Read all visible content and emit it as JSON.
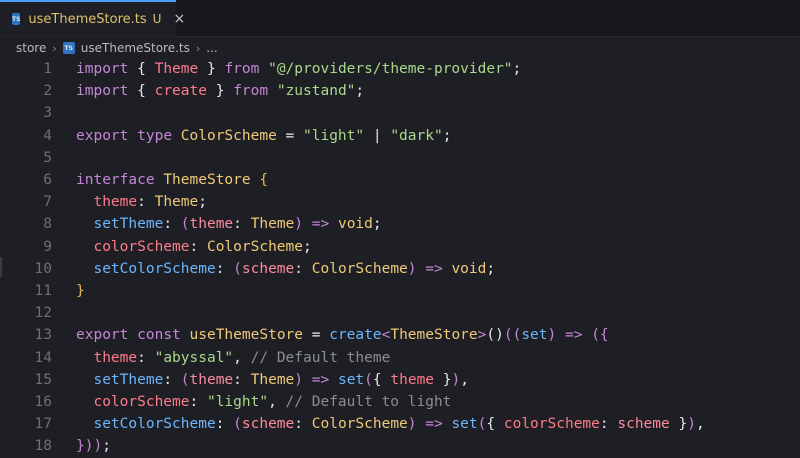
{
  "tab": {
    "badge": "TS",
    "name": "useThemeStore.ts",
    "status": "U",
    "close": "×"
  },
  "breadcrumb": {
    "folder": "store",
    "file": "useThemeStore.ts",
    "more": "..."
  },
  "lines": [
    {
      "n": "1",
      "tokens": [
        [
          "k",
          "import"
        ],
        [
          "o",
          " { "
        ],
        [
          "p",
          "Theme"
        ],
        [
          "o",
          " } "
        ],
        [
          "k",
          "from"
        ],
        [
          "o",
          " "
        ],
        [
          "s",
          "\"@/providers/theme-provider\""
        ],
        [
          "o",
          ";"
        ]
      ]
    },
    {
      "n": "2",
      "tokens": [
        [
          "k",
          "import"
        ],
        [
          "o",
          " { "
        ],
        [
          "p",
          "create"
        ],
        [
          "o",
          " } "
        ],
        [
          "k",
          "from"
        ],
        [
          "o",
          " "
        ],
        [
          "s",
          "\"zustand\""
        ],
        [
          "o",
          ";"
        ]
      ]
    },
    {
      "n": "3",
      "tokens": []
    },
    {
      "n": "4",
      "tokens": [
        [
          "k",
          "export"
        ],
        [
          "o",
          " "
        ],
        [
          "k",
          "type"
        ],
        [
          "o",
          " "
        ],
        [
          "t",
          "ColorScheme"
        ],
        [
          "o",
          " = "
        ],
        [
          "s",
          "\"light\""
        ],
        [
          "o",
          " | "
        ],
        [
          "s",
          "\"dark\""
        ],
        [
          "o",
          ";"
        ]
      ]
    },
    {
      "n": "5",
      "tokens": []
    },
    {
      "n": "6",
      "tokens": [
        [
          "k",
          "interface"
        ],
        [
          "o",
          " "
        ],
        [
          "t",
          "ThemeStore"
        ],
        [
          "o",
          " "
        ],
        [
          "br",
          "{"
        ]
      ]
    },
    {
      "n": "7",
      "tokens": [
        [
          "o",
          "  "
        ],
        [
          "p",
          "theme"
        ],
        [
          "o",
          ": "
        ],
        [
          "t",
          "Theme"
        ],
        [
          "o",
          ";"
        ]
      ]
    },
    {
      "n": "8",
      "tokens": [
        [
          "o",
          "  "
        ],
        [
          "f",
          "setTheme"
        ],
        [
          "o",
          ": "
        ],
        [
          "k",
          "("
        ],
        [
          "pm",
          "theme"
        ],
        [
          "o",
          ": "
        ],
        [
          "t",
          "Theme"
        ],
        [
          "k",
          ")"
        ],
        [
          "o",
          " "
        ],
        [
          "k",
          "=>"
        ],
        [
          "o",
          " "
        ],
        [
          "t",
          "void"
        ],
        [
          "o",
          ";"
        ]
      ]
    },
    {
      "n": "9",
      "tokens": [
        [
          "o",
          "  "
        ],
        [
          "p",
          "colorScheme"
        ],
        [
          "o",
          ": "
        ],
        [
          "t",
          "ColorScheme"
        ],
        [
          "o",
          ";"
        ]
      ]
    },
    {
      "n": "10",
      "tokens": [
        [
          "o",
          "  "
        ],
        [
          "f",
          "setColorScheme"
        ],
        [
          "o",
          ": "
        ],
        [
          "k",
          "("
        ],
        [
          "pm",
          "scheme"
        ],
        [
          "o",
          ": "
        ],
        [
          "t",
          "ColorScheme"
        ],
        [
          "k",
          ")"
        ],
        [
          "o",
          " "
        ],
        [
          "k",
          "=>"
        ],
        [
          "o",
          " "
        ],
        [
          "t",
          "void"
        ],
        [
          "o",
          ";"
        ]
      ]
    },
    {
      "n": "11",
      "tokens": [
        [
          "br",
          "}"
        ]
      ]
    },
    {
      "n": "12",
      "tokens": []
    },
    {
      "n": "13",
      "tokens": [
        [
          "k",
          "export"
        ],
        [
          "o",
          " "
        ],
        [
          "k",
          "const"
        ],
        [
          "o",
          " "
        ],
        [
          "t",
          "useThemeStore"
        ],
        [
          "o",
          " = "
        ],
        [
          "f",
          "create"
        ],
        [
          "k",
          "<"
        ],
        [
          "t",
          "ThemeStore"
        ],
        [
          "k",
          ">"
        ],
        [
          "o",
          "()"
        ],
        [
          "k",
          "(("
        ],
        [
          "f",
          "set"
        ],
        [
          "k",
          ")"
        ],
        [
          "o",
          " "
        ],
        [
          "k",
          "=>"
        ],
        [
          "o",
          " "
        ],
        [
          "k",
          "({"
        ]
      ]
    },
    {
      "n": "14",
      "tokens": [
        [
          "o",
          "  "
        ],
        [
          "p",
          "theme"
        ],
        [
          "o",
          ": "
        ],
        [
          "s",
          "\"abyssal\""
        ],
        [
          "o",
          ", "
        ],
        [
          "c",
          "// Default theme"
        ]
      ]
    },
    {
      "n": "15",
      "tokens": [
        [
          "o",
          "  "
        ],
        [
          "f",
          "setTheme"
        ],
        [
          "o",
          ": "
        ],
        [
          "k",
          "("
        ],
        [
          "pm",
          "theme"
        ],
        [
          "o",
          ": "
        ],
        [
          "t",
          "Theme"
        ],
        [
          "k",
          ")"
        ],
        [
          "o",
          " "
        ],
        [
          "k",
          "=>"
        ],
        [
          "o",
          " "
        ],
        [
          "f",
          "set"
        ],
        [
          "k",
          "("
        ],
        [
          "o",
          "{ "
        ],
        [
          "p",
          "theme"
        ],
        [
          "o",
          " }"
        ],
        [
          "k",
          ")"
        ],
        [
          "o",
          ","
        ]
      ]
    },
    {
      "n": "16",
      "tokens": [
        [
          "o",
          "  "
        ],
        [
          "p",
          "colorScheme"
        ],
        [
          "o",
          ": "
        ],
        [
          "s",
          "\"light\""
        ],
        [
          "o",
          ", "
        ],
        [
          "c",
          "// Default to light"
        ]
      ]
    },
    {
      "n": "17",
      "tokens": [
        [
          "o",
          "  "
        ],
        [
          "f",
          "setColorScheme"
        ],
        [
          "o",
          ": "
        ],
        [
          "k",
          "("
        ],
        [
          "pm",
          "scheme"
        ],
        [
          "o",
          ": "
        ],
        [
          "t",
          "ColorScheme"
        ],
        [
          "k",
          ")"
        ],
        [
          "o",
          " "
        ],
        [
          "k",
          "=>"
        ],
        [
          "o",
          " "
        ],
        [
          "f",
          "set"
        ],
        [
          "k",
          "("
        ],
        [
          "o",
          "{ "
        ],
        [
          "p",
          "colorScheme"
        ],
        [
          "o",
          ": "
        ],
        [
          "pm",
          "scheme"
        ],
        [
          "o",
          " }"
        ],
        [
          "k",
          ")"
        ],
        [
          "o",
          ","
        ]
      ]
    },
    {
      "n": "18",
      "tokens": [
        [
          "k",
          "}))"
        ],
        [
          "o",
          ";"
        ]
      ]
    }
  ]
}
